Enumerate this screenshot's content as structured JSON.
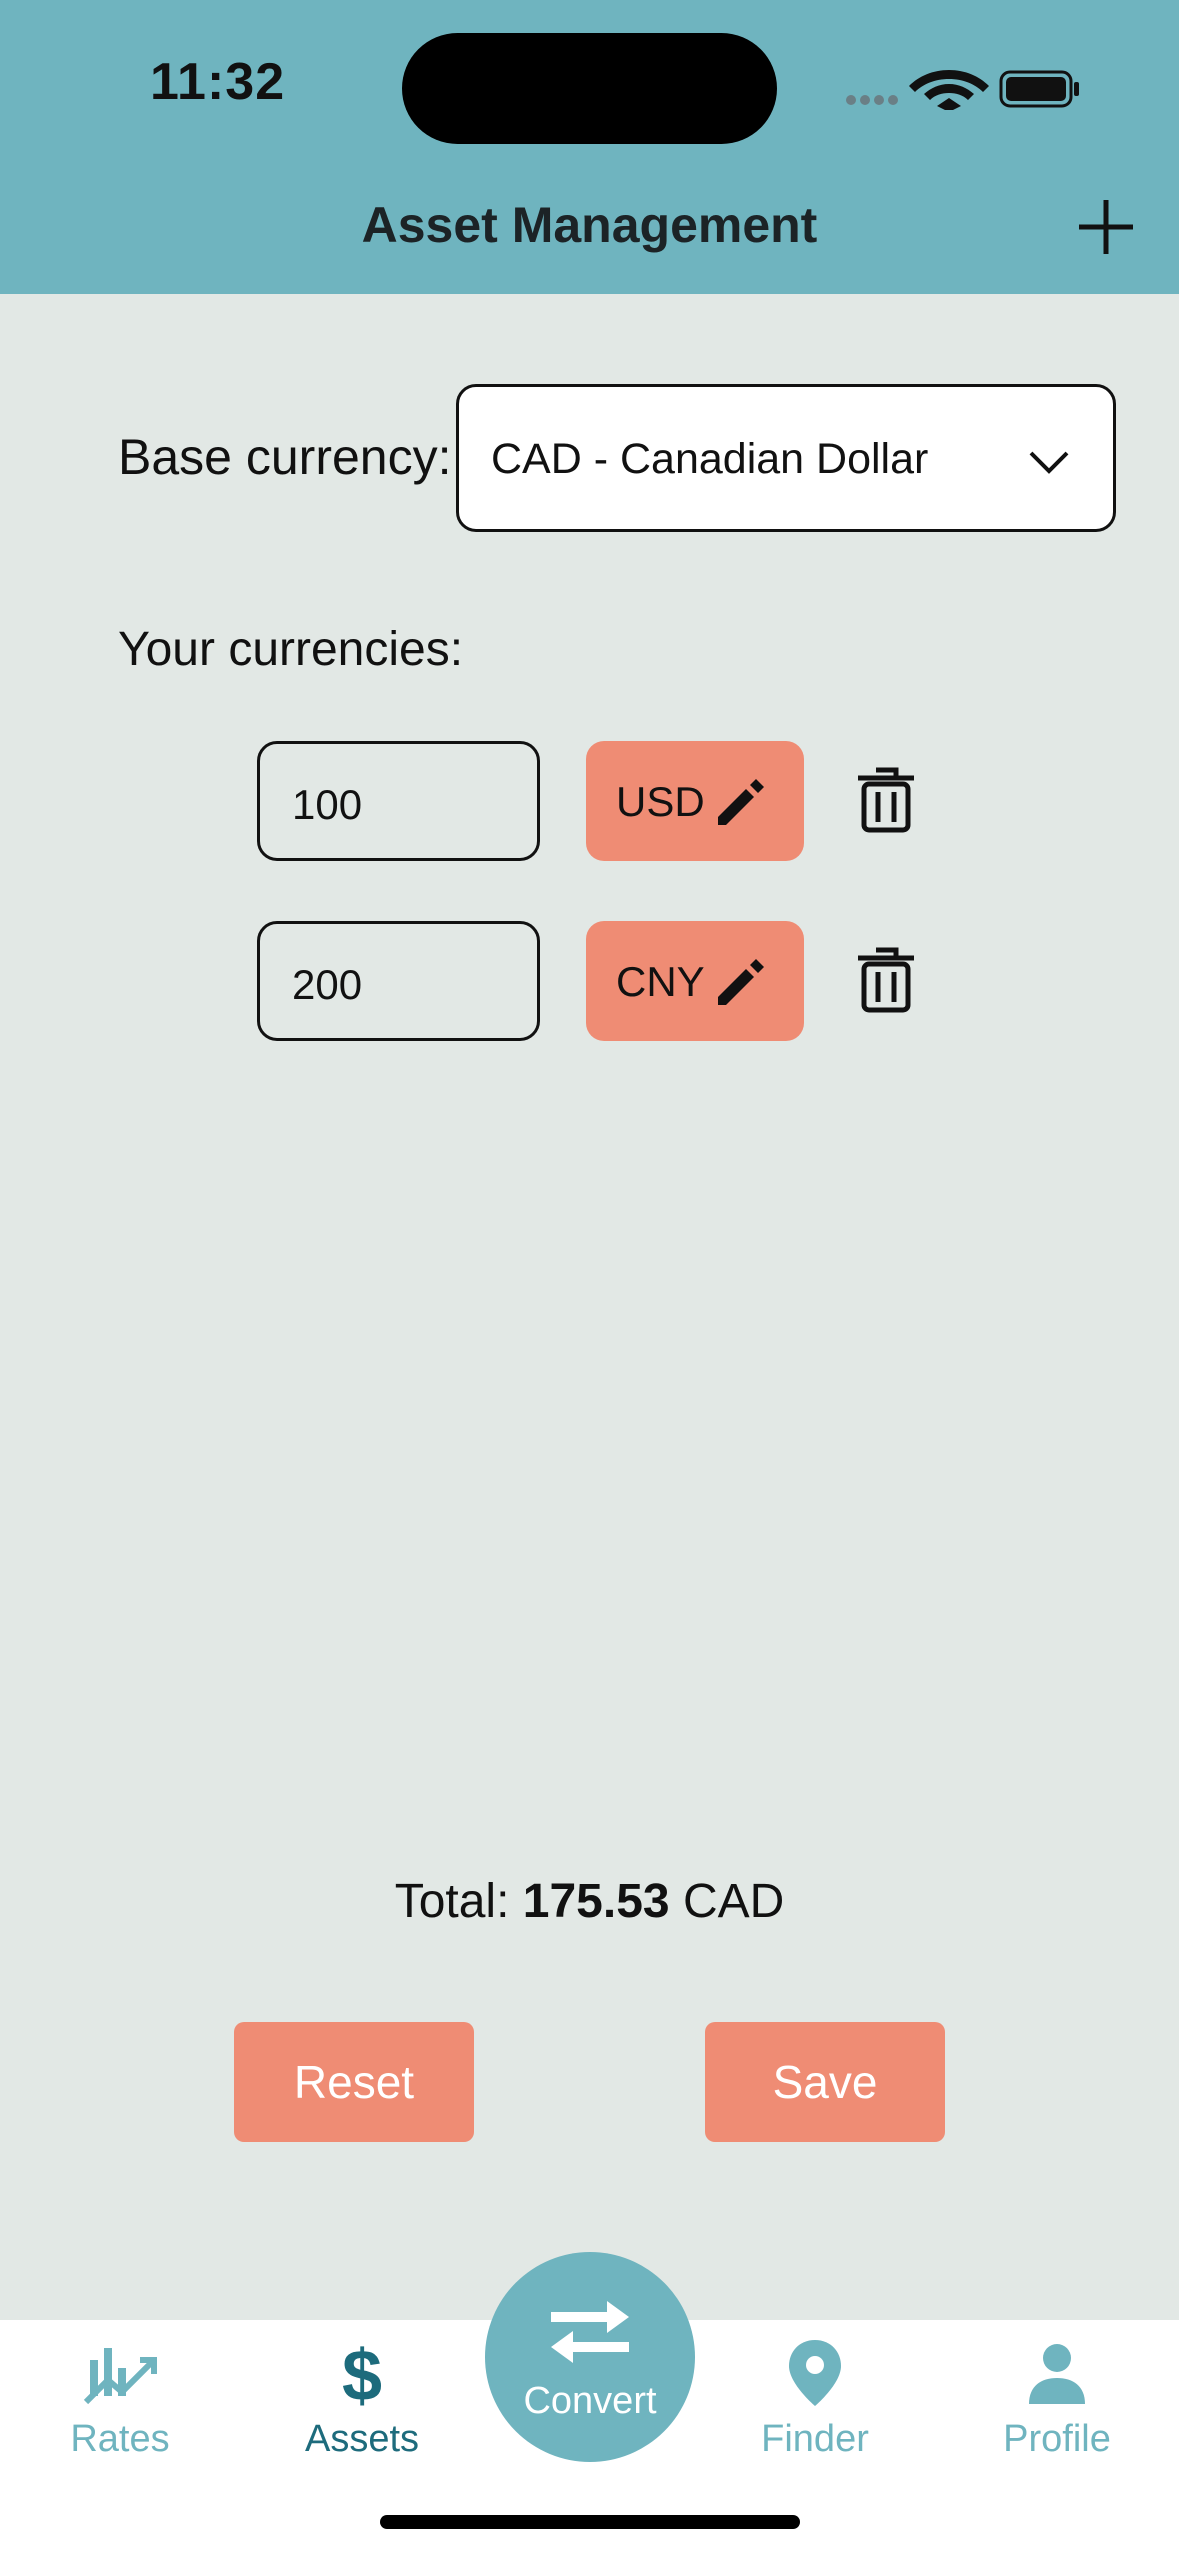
{
  "status": {
    "time": "11:32"
  },
  "header": {
    "title": "Asset Management"
  },
  "base": {
    "label": "Base currency:",
    "selected": "CAD - Canadian Dollar"
  },
  "currencies_label": "Your currencies:",
  "assets": [
    {
      "amount": "100",
      "code": "USD"
    },
    {
      "amount": "200",
      "code": "CNY"
    }
  ],
  "total": {
    "prefix": "Total:",
    "value": "175.53",
    "unit": "CAD"
  },
  "actions": {
    "reset": "Reset",
    "save": "Save"
  },
  "tabs": {
    "rates": "Rates",
    "assets": "Assets",
    "convert": "Convert",
    "finder": "Finder",
    "profile": "Profile"
  },
  "colors": {
    "header": "#6fb4bf",
    "accent": "#ef8c74",
    "background": "#e2e8e5",
    "active_tab": "#1d6b7c"
  }
}
